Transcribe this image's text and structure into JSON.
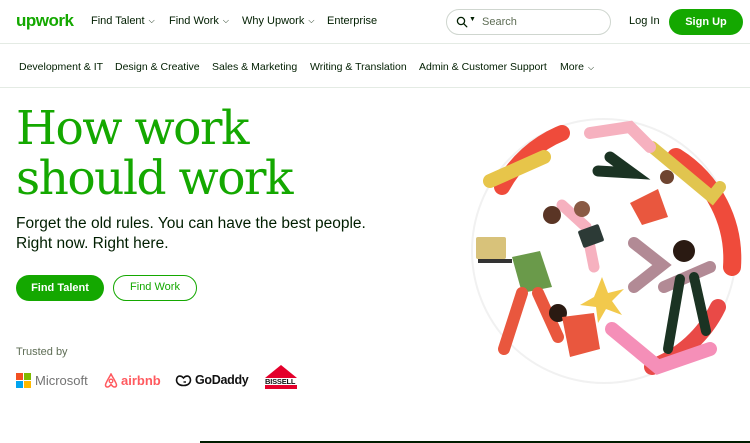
{
  "header": {
    "logo": "upwork",
    "nav": [
      {
        "label": "Find Talent",
        "chevron": true
      },
      {
        "label": "Find Work",
        "chevron": true
      },
      {
        "label": "Why Upwork",
        "chevron": true
      },
      {
        "label": "Enterprise",
        "chevron": false
      }
    ],
    "search_placeholder": "Search",
    "login": "Log In",
    "signup": "Sign Up"
  },
  "categories": [
    "Development & IT",
    "Design & Creative",
    "Sales & Marketing",
    "Writing & Translation",
    "Admin & Customer Support",
    "More"
  ],
  "hero": {
    "title_line1": "How work",
    "title_line2": "should work",
    "subtitle_line1": "Forget the old rules. You can have the best people.",
    "subtitle_line2": "Right now. Right here.",
    "primary_button": "Find Talent",
    "secondary_button": "Find Work"
  },
  "trusted": {
    "label": "Trusted by",
    "brands": [
      "Microsoft",
      "airbnb",
      "GoDaddy",
      "BISSELL"
    ]
  },
  "colors": {
    "brand_green": "#14a800",
    "text_dark": "#001e00",
    "muted": "#5e6d55"
  }
}
